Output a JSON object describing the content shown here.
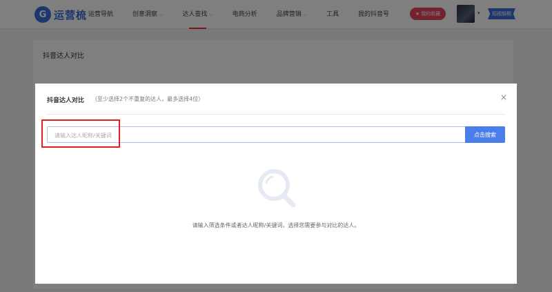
{
  "logo": {
    "mark": "G",
    "text": "运营梳"
  },
  "nav": {
    "items": [
      {
        "label": "运营导航",
        "caret": false,
        "active": false
      },
      {
        "label": "创意洞察",
        "caret": true,
        "active": false
      },
      {
        "label": "达人查找",
        "caret": true,
        "active": true
      },
      {
        "label": "电商分析",
        "caret": false,
        "active": false
      },
      {
        "label": "品牌营销",
        "caret": true,
        "active": false
      },
      {
        "label": "工具",
        "caret": false,
        "active": false
      },
      {
        "label": "我的抖音号",
        "caret": false,
        "active": false
      }
    ],
    "caret_glyph": "⌵"
  },
  "header": {
    "favorites_label": "我的收藏",
    "favorites_icon": "★",
    "avatar_caret": "▾",
    "trial_label": "招视频期"
  },
  "page": {
    "title": "抖音达人对比"
  },
  "modal": {
    "title": "抖音达人对比",
    "subtitle": "（至少选择2个不重复的达人，最多选择4位）",
    "close_glyph": "×",
    "search_placeholder": "请输入达人昵称/关键词",
    "search_value": "",
    "search_button_label": "点击搜索",
    "empty_text": "请输入筛选条件或者达人昵称/关键词，选择您需要参与对比的达人。"
  },
  "colors": {
    "brand_blue": "#3a6fd8",
    "search_blue": "#4a7ee8",
    "accent_red": "#e6303f",
    "favorites_pink": "#e6455a",
    "highlight_red": "#e02020"
  },
  "icons": {
    "logo": "logo-icon",
    "favorites": "star-icon",
    "close": "close-icon",
    "empty": "magnifier-icon"
  }
}
